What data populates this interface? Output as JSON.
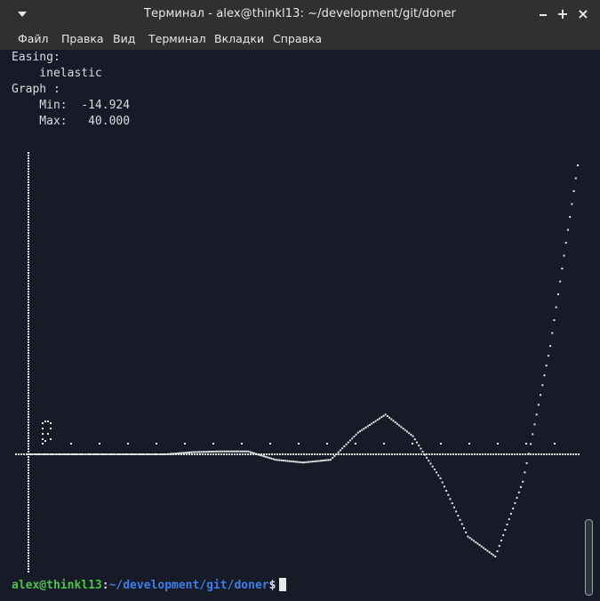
{
  "window": {
    "title": "Терминал - alex@thinkl13: ~/development/git/doner",
    "menu_icon": "chevron-down-icon",
    "controls": {
      "minimize": "minimize-icon",
      "maximize": "+",
      "close": "×"
    }
  },
  "menubar": {
    "items": [
      "Файл",
      "Правка",
      "Вид",
      "Терминал",
      "Вкладки",
      "Справка"
    ]
  },
  "terminal": {
    "lines": [
      "Easing:",
      "    inelastic",
      "Graph :",
      "    Min:  -14.924",
      "    Max:   40.000"
    ],
    "prompt": {
      "user_host": "alex@thinkl13",
      "colon": ":",
      "path": "~/development/git/doner",
      "symbol": "$"
    }
  },
  "chart_data": {
    "type": "scatter",
    "description_style": "ascii braille-dot plot of easing curve",
    "x": [
      0.0,
      0.05,
      0.1,
      0.15,
      0.2,
      0.25,
      0.3,
      0.35,
      0.4,
      0.45,
      0.5,
      0.55,
      0.6,
      0.65,
      0.7,
      0.75,
      0.8,
      0.85,
      0.9,
      0.95,
      1.0
    ],
    "y": [
      0.0,
      0.0,
      0.0,
      0.0,
      0.0,
      0.0,
      0.3,
      0.4,
      0.4,
      -0.8,
      -1.2,
      -0.8,
      3.0,
      5.5,
      2.5,
      -3.5,
      -12.0,
      -14.924,
      -4.0,
      15.0,
      40.0
    ],
    "ylim": [
      -14.924,
      40.0
    ],
    "grid": false
  }
}
